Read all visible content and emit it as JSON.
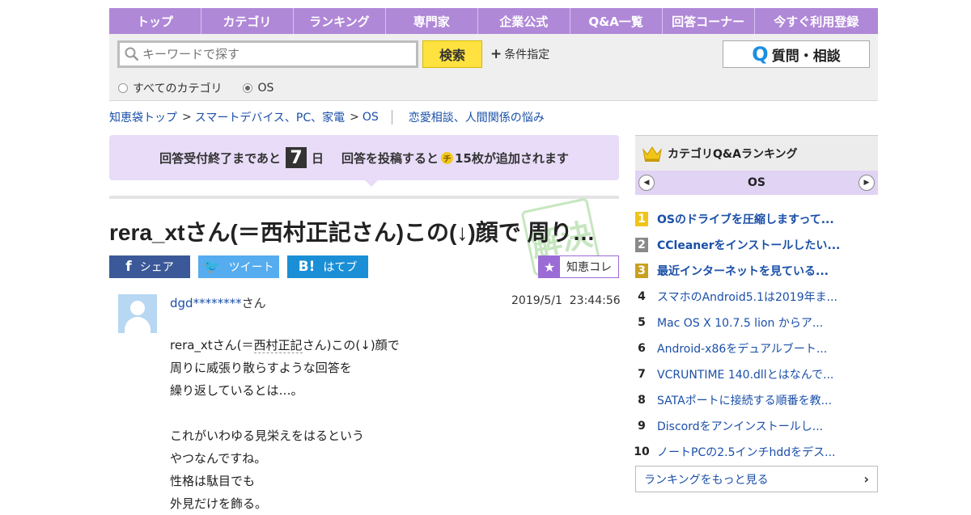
{
  "nav": [
    "トップ",
    "カテゴリ",
    "ランキング",
    "専門家",
    "企業公式",
    "Q&A一覧",
    "回答コーナー",
    "今すぐ利用登録"
  ],
  "search": {
    "placeholder": "キーワードで探す",
    "button": "検索",
    "conditions": "条件指定",
    "ask_button": "質問・相談",
    "ask_icon": "Q",
    "radio_all": "すべてのカテゴリ",
    "radio_os": "OS"
  },
  "breadcrumb": {
    "items": [
      "知恵袋トップ",
      "スマートデバイス、PC、家電",
      "OS"
    ],
    "sep": ">",
    "related": "恋愛相談、人間関係の悩み"
  },
  "notice": {
    "prefix": "回答受付終了まであと",
    "days": "7",
    "days_unit": "日",
    "middle": "回答を投稿すると",
    "coin": "チ",
    "suffix": "15枚が追加されます"
  },
  "question": {
    "title": "rera_xtさん(＝西村正記さん)この(↓)顔で 周り…",
    "stamp": "解決"
  },
  "share": {
    "facebook_icon": "f",
    "facebook": "シェア",
    "twitter_icon": "🐦",
    "twitter": "ツイート",
    "hatena_icon": "B!",
    "hatena": "はてブ",
    "chiecolle_icon": "★",
    "chiecolle": "知恵コレ"
  },
  "answer": {
    "username": "dgd********",
    "user_suffix": "さん",
    "date": "2019/5/1  23:44:56",
    "lines": [
      {
        "pre": "rera_xtさん(＝",
        "u": "西村正記",
        "post": "さん)この(↓)顔で"
      },
      {
        "pre": "周りに威張り散らすような回答を",
        "u": "",
        "post": ""
      },
      {
        "pre": "繰り返しているとは…。",
        "u": "",
        "post": ""
      },
      {
        "pre": "",
        "u": "",
        "post": ""
      },
      {
        "pre": "これがいわゆる見栄えをはるという",
        "u": "",
        "post": ""
      },
      {
        "pre": "やつなんですね。",
        "u": "",
        "post": ""
      },
      {
        "pre": "性格は駄目でも",
        "u": "",
        "post": ""
      },
      {
        "pre": "外見だけを飾る。",
        "u": "",
        "post": ""
      }
    ]
  },
  "sidebar": {
    "title": "カテゴリQ&Aランキング",
    "category": "OS",
    "prev": "◀",
    "next": "▶",
    "ranking": [
      {
        "n": "1",
        "text": "OSのドライブを圧縮しますって..."
      },
      {
        "n": "2",
        "text": "CCleanerをインストールしたい..."
      },
      {
        "n": "3",
        "text": "最近インターネットを見ている..."
      },
      {
        "n": "4",
        "text": "スマホのAndroid5.1は2019年ま..."
      },
      {
        "n": "5",
        "text": "Mac OS X 10.7.5 lion からア..."
      },
      {
        "n": "6",
        "text": "Android-x86をデュアルブート..."
      },
      {
        "n": "7",
        "text": "VCRUNTIME 140.dllとはなんで..."
      },
      {
        "n": "8",
        "text": "SATAポートに接続する順番を教..."
      },
      {
        "n": "9",
        "text": "Discordをアンインストールし..."
      },
      {
        "n": "10",
        "text": "ノートPCの2.5インチhddをデス..."
      }
    ],
    "rank_colors": [
      "#f0c419",
      "#8a8a8a",
      "#c9a020"
    ],
    "more": "ランキングをもっと見る",
    "more_icon": "›"
  }
}
